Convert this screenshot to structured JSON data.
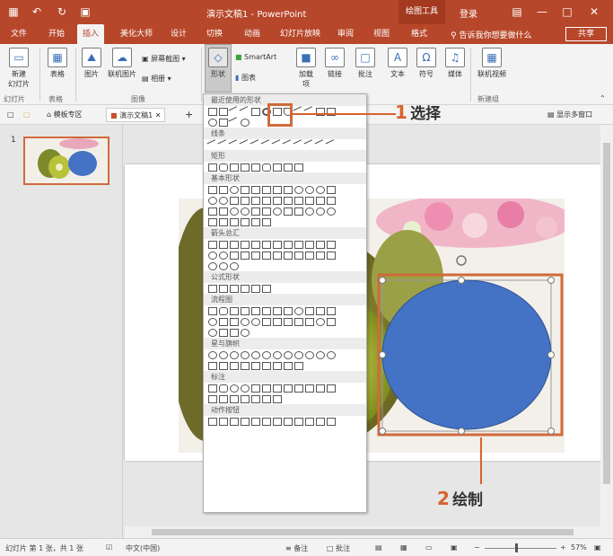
{
  "window": {
    "title": "演示文稿1 - PowerPoint",
    "context_tab": "绘图工具",
    "login": "登录"
  },
  "tabs": [
    "文件",
    "开始",
    "插入",
    "美化大师",
    "设计",
    "切换",
    "动画",
    "幻灯片放映",
    "审阅",
    "视图",
    "格式"
  ],
  "active_tab": "插入",
  "tell_me": "告诉我你想要做什么",
  "share": "共享",
  "ribbon": {
    "new_slide": "新建\n幻灯片",
    "table": "表格",
    "picture": "图片",
    "online_picture": "联机图片",
    "screenshot": "屏幕截图",
    "album": "相册",
    "shapes": "形状",
    "smartart": "SmartArt",
    "chart": "图表",
    "addins": "加载\n项",
    "link": "链接",
    "comment": "批注",
    "text": "文本",
    "symbol": "符号",
    "media": "媒体",
    "online_video": "联机视频",
    "groups": [
      "幻灯片",
      "表格",
      "图像",
      "新建组"
    ]
  },
  "doc_tabs": [
    "模板专区",
    "演示文稿1"
  ],
  "multi_window": "显示多窗口",
  "slide_number": "1",
  "shapes_menu": {
    "sections": [
      "最近使用的形状",
      "线条",
      "矩形",
      "基本形状",
      "箭头总汇",
      "公式形状",
      "流程图",
      "星与旗帜",
      "标注",
      "动作按钮"
    ]
  },
  "annotations": {
    "step1_num": "1",
    "step1_label": "选择",
    "step2_num": "2",
    "step2_label": "绘制"
  },
  "status": {
    "slide_info": "幻灯片 第 1 张，共 1 张",
    "language": "中文(中国)",
    "notes": "备注",
    "comments": "批注",
    "zoom": "57%"
  },
  "colors": {
    "accent": "#b7472a",
    "ellipse_fill": "#4472c4",
    "callout": "#d9622b"
  }
}
